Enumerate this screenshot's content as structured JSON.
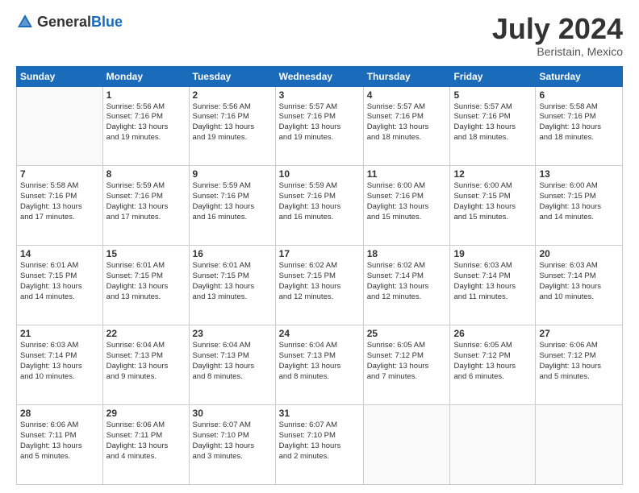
{
  "logo": {
    "general": "General",
    "blue": "Blue"
  },
  "title": "July 2024",
  "location": "Beristain, Mexico",
  "days_of_week": [
    "Sunday",
    "Monday",
    "Tuesday",
    "Wednesday",
    "Thursday",
    "Friday",
    "Saturday"
  ],
  "weeks": [
    [
      {
        "num": "",
        "info": ""
      },
      {
        "num": "1",
        "info": "Sunrise: 5:56 AM\nSunset: 7:16 PM\nDaylight: 13 hours\nand 19 minutes."
      },
      {
        "num": "2",
        "info": "Sunrise: 5:56 AM\nSunset: 7:16 PM\nDaylight: 13 hours\nand 19 minutes."
      },
      {
        "num": "3",
        "info": "Sunrise: 5:57 AM\nSunset: 7:16 PM\nDaylight: 13 hours\nand 19 minutes."
      },
      {
        "num": "4",
        "info": "Sunrise: 5:57 AM\nSunset: 7:16 PM\nDaylight: 13 hours\nand 18 minutes."
      },
      {
        "num": "5",
        "info": "Sunrise: 5:57 AM\nSunset: 7:16 PM\nDaylight: 13 hours\nand 18 minutes."
      },
      {
        "num": "6",
        "info": "Sunrise: 5:58 AM\nSunset: 7:16 PM\nDaylight: 13 hours\nand 18 minutes."
      }
    ],
    [
      {
        "num": "7",
        "info": "Sunrise: 5:58 AM\nSunset: 7:16 PM\nDaylight: 13 hours\nand 17 minutes."
      },
      {
        "num": "8",
        "info": "Sunrise: 5:59 AM\nSunset: 7:16 PM\nDaylight: 13 hours\nand 17 minutes."
      },
      {
        "num": "9",
        "info": "Sunrise: 5:59 AM\nSunset: 7:16 PM\nDaylight: 13 hours\nand 16 minutes."
      },
      {
        "num": "10",
        "info": "Sunrise: 5:59 AM\nSunset: 7:16 PM\nDaylight: 13 hours\nand 16 minutes."
      },
      {
        "num": "11",
        "info": "Sunrise: 6:00 AM\nSunset: 7:16 PM\nDaylight: 13 hours\nand 15 minutes."
      },
      {
        "num": "12",
        "info": "Sunrise: 6:00 AM\nSunset: 7:15 PM\nDaylight: 13 hours\nand 15 minutes."
      },
      {
        "num": "13",
        "info": "Sunrise: 6:00 AM\nSunset: 7:15 PM\nDaylight: 13 hours\nand 14 minutes."
      }
    ],
    [
      {
        "num": "14",
        "info": "Sunrise: 6:01 AM\nSunset: 7:15 PM\nDaylight: 13 hours\nand 14 minutes."
      },
      {
        "num": "15",
        "info": "Sunrise: 6:01 AM\nSunset: 7:15 PM\nDaylight: 13 hours\nand 13 minutes."
      },
      {
        "num": "16",
        "info": "Sunrise: 6:01 AM\nSunset: 7:15 PM\nDaylight: 13 hours\nand 13 minutes."
      },
      {
        "num": "17",
        "info": "Sunrise: 6:02 AM\nSunset: 7:15 PM\nDaylight: 13 hours\nand 12 minutes."
      },
      {
        "num": "18",
        "info": "Sunrise: 6:02 AM\nSunset: 7:14 PM\nDaylight: 13 hours\nand 12 minutes."
      },
      {
        "num": "19",
        "info": "Sunrise: 6:03 AM\nSunset: 7:14 PM\nDaylight: 13 hours\nand 11 minutes."
      },
      {
        "num": "20",
        "info": "Sunrise: 6:03 AM\nSunset: 7:14 PM\nDaylight: 13 hours\nand 10 minutes."
      }
    ],
    [
      {
        "num": "21",
        "info": "Sunrise: 6:03 AM\nSunset: 7:14 PM\nDaylight: 13 hours\nand 10 minutes."
      },
      {
        "num": "22",
        "info": "Sunrise: 6:04 AM\nSunset: 7:13 PM\nDaylight: 13 hours\nand 9 minutes."
      },
      {
        "num": "23",
        "info": "Sunrise: 6:04 AM\nSunset: 7:13 PM\nDaylight: 13 hours\nand 8 minutes."
      },
      {
        "num": "24",
        "info": "Sunrise: 6:04 AM\nSunset: 7:13 PM\nDaylight: 13 hours\nand 8 minutes."
      },
      {
        "num": "25",
        "info": "Sunrise: 6:05 AM\nSunset: 7:12 PM\nDaylight: 13 hours\nand 7 minutes."
      },
      {
        "num": "26",
        "info": "Sunrise: 6:05 AM\nSunset: 7:12 PM\nDaylight: 13 hours\nand 6 minutes."
      },
      {
        "num": "27",
        "info": "Sunrise: 6:06 AM\nSunset: 7:12 PM\nDaylight: 13 hours\nand 5 minutes."
      }
    ],
    [
      {
        "num": "28",
        "info": "Sunrise: 6:06 AM\nSunset: 7:11 PM\nDaylight: 13 hours\nand 5 minutes."
      },
      {
        "num": "29",
        "info": "Sunrise: 6:06 AM\nSunset: 7:11 PM\nDaylight: 13 hours\nand 4 minutes."
      },
      {
        "num": "30",
        "info": "Sunrise: 6:07 AM\nSunset: 7:10 PM\nDaylight: 13 hours\nand 3 minutes."
      },
      {
        "num": "31",
        "info": "Sunrise: 6:07 AM\nSunset: 7:10 PM\nDaylight: 13 hours\nand 2 minutes."
      },
      {
        "num": "",
        "info": ""
      },
      {
        "num": "",
        "info": ""
      },
      {
        "num": "",
        "info": ""
      }
    ]
  ]
}
